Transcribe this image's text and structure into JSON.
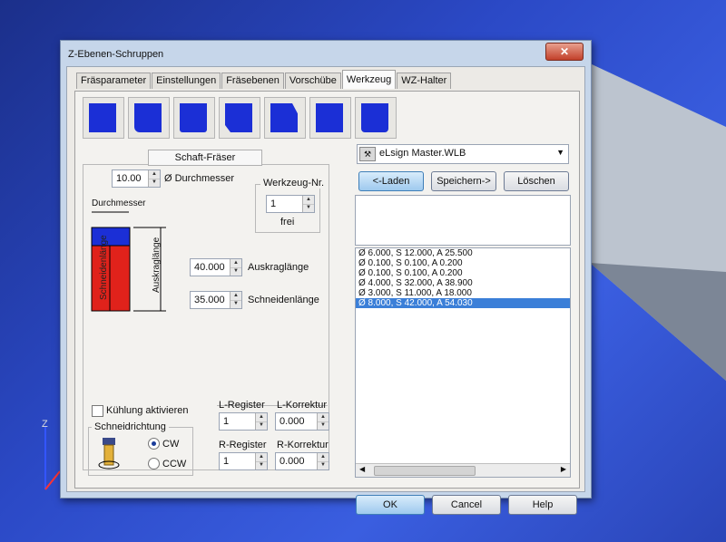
{
  "window": {
    "title": "Z-Ebenen-Schruppen",
    "close_label": "✕"
  },
  "tabs": [
    "Fräsparameter",
    "Einstellungen",
    "Fräsebenen",
    "Vorschübe",
    "Werkzeug",
    "WZ-Halter"
  ],
  "active_tab": "Werkzeug",
  "tool_group": {
    "label": "Schaft-Fräser"
  },
  "diameter": {
    "value": "10.00",
    "label": "Ø Durchmesser",
    "diagram_label": "Durchmesser"
  },
  "tool_number": {
    "label": "Werkzeug-Nr.",
    "value": "1",
    "status": "frei"
  },
  "projection": {
    "value": "40.000",
    "label": "Auskraglänge"
  },
  "cutting_length": {
    "value": "35.000",
    "label": "Schneidenlänge"
  },
  "diagram": {
    "cutting_label": "Schneidenlänge",
    "projection_label": "Auskraglänge"
  },
  "cooling": {
    "label": "Kühlung aktivieren",
    "checked": false
  },
  "cut_direction": {
    "label": "Schneidrichtung",
    "cw": "CW",
    "ccw": "CCW",
    "selected": "CW"
  },
  "registers": {
    "l_register_label": "L-Register",
    "l_register_value": "1",
    "l_korrektur_label": "L-Korrektur",
    "l_korrektur_value": "0.000",
    "r_register_label": "R-Register",
    "r_register_value": "1",
    "r_korrektur_label": "R-Korrektur",
    "r_korrektur_value": "0.000"
  },
  "library": {
    "name": "eLsign Master.WLB"
  },
  "library_buttons": {
    "load": "<-Laden",
    "save": "Speichern->",
    "delete": "Löschen"
  },
  "tool_list": [
    "Ø 6.000, S 12.000, A 25.500",
    "Ø 0.100, S 0.100, A 0.200",
    "Ø 0.100, S 0.100, A 0.200",
    "Ø 4.000, S 32.000, A 38.900",
    "Ø 3.000, S 11.000, A 18.000",
    "Ø 8.000, S 42.000, A 54.030"
  ],
  "selected_tool_index": 5,
  "footer": {
    "ok": "OK",
    "cancel": "Cancel",
    "help": "Help"
  },
  "axis": {
    "z": "Z"
  },
  "colors": {
    "tool_blue": "#1b2fd6",
    "tool_red": "#e0221b",
    "selection": "#3b7fd8"
  }
}
